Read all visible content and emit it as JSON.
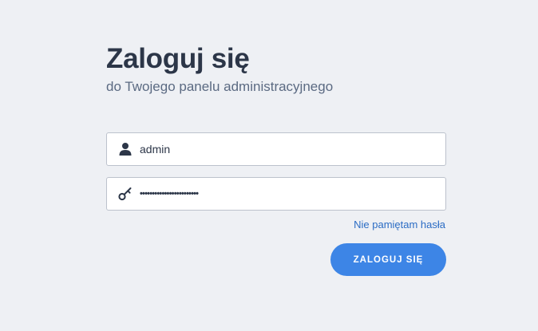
{
  "header": {
    "title": "Zaloguj się",
    "subtitle": "do Twojego panelu administracyjnego"
  },
  "login_form": {
    "username": {
      "value": "admin",
      "icon": "user-icon"
    },
    "password": {
      "value": "••••••••••••••••••••••••",
      "icon": "key-icon"
    },
    "forgot_password_label": "Nie pamiętam hasła",
    "submit_label": "ZALOGUJ SIĘ"
  },
  "colors": {
    "background": "#eef0f4",
    "accent": "#3d85e6",
    "link": "#2b6cc4",
    "heading": "#2c3648"
  }
}
